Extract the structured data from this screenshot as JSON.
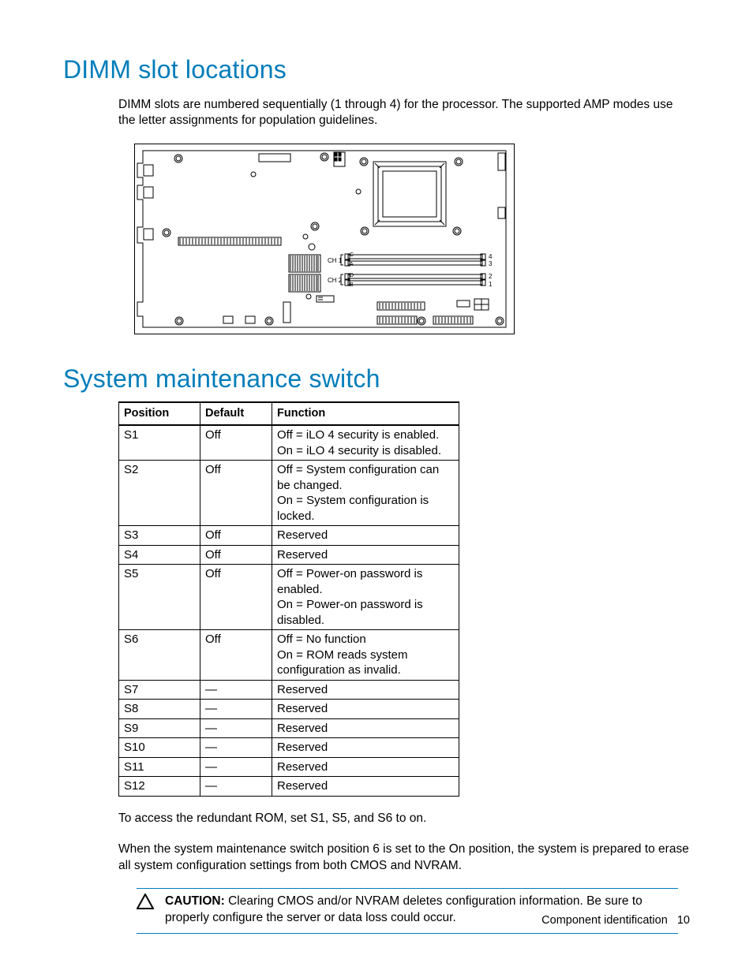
{
  "heading1": "DIMM slot locations",
  "para1": "DIMM slots are numbered sequentially (1 through 4) for the processor. The supported AMP modes use the letter assignments for population guidelines.",
  "diagram_labels": {
    "ch1": "CH 1",
    "ch2": "CH 2",
    "a": "A",
    "b": "B",
    "c": "C",
    "d": "D",
    "n1": "1",
    "n2": "2",
    "n3": "3",
    "n4": "4"
  },
  "heading2": "System maintenance switch",
  "table": {
    "headers": [
      "Position",
      "Default",
      "Function"
    ],
    "rows": [
      {
        "pos": "S1",
        "def": "Off",
        "fn": "Off = iLO 4 security is enabled.\nOn = iLO 4 security is disabled."
      },
      {
        "pos": "S2",
        "def": "Off",
        "fn": "Off = System configuration can be changed.\nOn = System configuration is locked."
      },
      {
        "pos": "S3",
        "def": "Off",
        "fn": "Reserved"
      },
      {
        "pos": "S4",
        "def": "Off",
        "fn": "Reserved"
      },
      {
        "pos": "S5",
        "def": "Off",
        "fn": "Off = Power-on password is enabled.\nOn = Power-on password is disabled."
      },
      {
        "pos": "S6",
        "def": "Off",
        "fn": "Off = No function\nOn = ROM reads system configuration as invalid."
      },
      {
        "pos": "S7",
        "def": "—",
        "fn": "Reserved"
      },
      {
        "pos": "S8",
        "def": "—",
        "fn": "Reserved"
      },
      {
        "pos": "S9",
        "def": "—",
        "fn": "Reserved"
      },
      {
        "pos": "S10",
        "def": "—",
        "fn": "Reserved"
      },
      {
        "pos": "S11",
        "def": "—",
        "fn": "Reserved"
      },
      {
        "pos": "S12",
        "def": "—",
        "fn": "Reserved"
      }
    ]
  },
  "para2": "To access the redundant ROM, set S1, S5, and S6 to on.",
  "para3": "When the system maintenance switch position 6 is set to the On position, the system is prepared to erase all system configuration settings from both CMOS and NVRAM.",
  "caution_label": "CAUTION:",
  "caution_text": " Clearing CMOS and/or NVRAM deletes configuration information. Be sure to properly configure the server or data loss could occur.",
  "footer_section": "Component identification",
  "footer_page": "10"
}
